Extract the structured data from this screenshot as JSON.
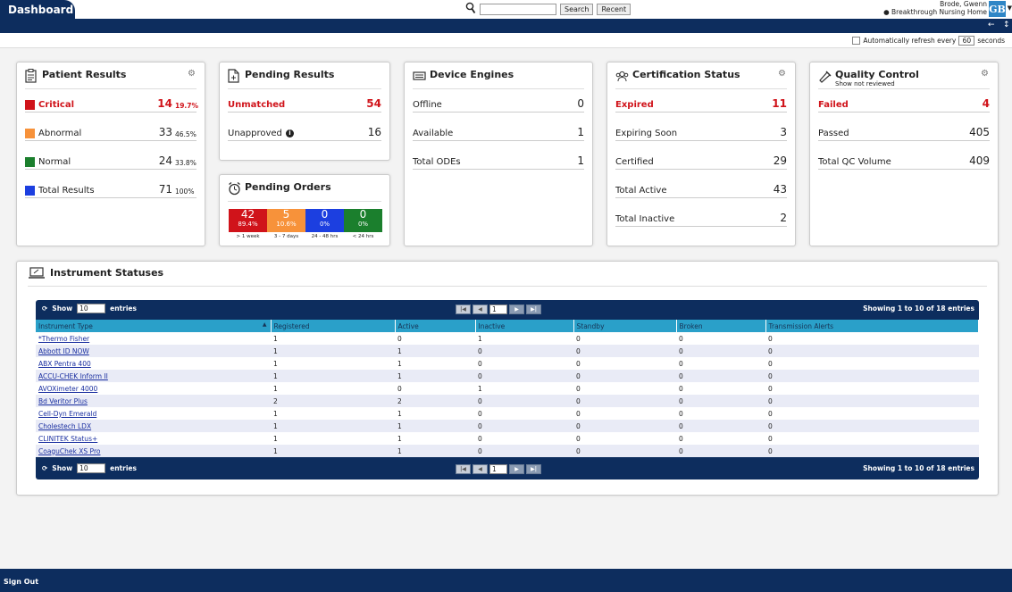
{
  "header": {
    "tab_title": "Dashboard",
    "search_placeholder": "",
    "search_button": "Search",
    "recent_button": "Recent",
    "user_name": "Brode, Gwenn",
    "location": "Breakthrough Nursing Home",
    "avatar_initials": "GB"
  },
  "nav": {
    "left_arrow": "←",
    "right_icon": "↕"
  },
  "refresh": {
    "label": "Automatically refresh every",
    "seconds_value": "60",
    "seconds_label": "seconds"
  },
  "patient_results": {
    "title": "Patient Results",
    "rows": [
      {
        "label": "Critical",
        "value": "14",
        "pct": "19.7%",
        "color": "#d0131a"
      },
      {
        "label": "Abnormal",
        "value": "33",
        "pct": "46.5%",
        "color": "#f7923a"
      },
      {
        "label": "Normal",
        "value": "24",
        "pct": "33.8%",
        "color": "#1b7f2d"
      },
      {
        "label": "Total Results",
        "value": "71",
        "pct": "100%",
        "color": "#1c3fe0"
      }
    ]
  },
  "pending_results": {
    "title": "Pending Results",
    "rows": [
      {
        "label": "Unmatched",
        "value": "54"
      },
      {
        "label": "Unapproved",
        "value": "16"
      }
    ]
  },
  "pending_orders": {
    "title": "Pending Orders",
    "blocks": [
      {
        "count": "42",
        "pct": "89.4%",
        "label": "> 1 week",
        "color": "#d0131a"
      },
      {
        "count": "5",
        "pct": "10.6%",
        "label": "3 - 7 days",
        "color": "#f7923a"
      },
      {
        "count": "0",
        "pct": "0%",
        "label": "24 - 48 hrs",
        "color": "#1c3fe0"
      },
      {
        "count": "0",
        "pct": "0%",
        "label": "< 24 hrs",
        "color": "#1b7f2d"
      }
    ]
  },
  "device_engines": {
    "title": "Device Engines",
    "rows": [
      {
        "label": "Offline",
        "value": "0"
      },
      {
        "label": "Available",
        "value": "1"
      },
      {
        "label": "Total ODEs",
        "value": "1"
      }
    ]
  },
  "certification_status": {
    "title": "Certification Status",
    "rows": [
      {
        "label": "Expired",
        "value": "11"
      },
      {
        "label": "Expiring Soon",
        "value": "3"
      },
      {
        "label": "Certified",
        "value": "29"
      },
      {
        "label": "Total Active",
        "value": "43"
      },
      {
        "label": "Total Inactive",
        "value": "2"
      }
    ]
  },
  "quality_control": {
    "title": "Quality Control",
    "subtitle": "Show not reviewed",
    "rows": [
      {
        "label": "Failed",
        "value": "4"
      },
      {
        "label": "Passed",
        "value": "405"
      },
      {
        "label": "Total QC Volume",
        "value": "409"
      }
    ]
  },
  "instrument_statuses": {
    "title": "Instrument Statuses",
    "show_label": "Show",
    "entries_value": "10",
    "entries_label": "entries",
    "page": "1",
    "showing": "Showing 1 to 10 of 18 entries",
    "columns": [
      "Instrument Type",
      "Registered",
      "Active",
      "Inactive",
      "Standby",
      "Broken",
      "Transmission Alerts"
    ],
    "rows": [
      [
        "*Thermo Fisher",
        "1",
        "0",
        "1",
        "0",
        "0",
        "0"
      ],
      [
        "Abbott ID NOW",
        "1",
        "1",
        "0",
        "0",
        "0",
        "0"
      ],
      [
        "ABX Pentra 400",
        "1",
        "1",
        "0",
        "0",
        "0",
        "0"
      ],
      [
        "ACCU-CHEK Inform II",
        "1",
        "1",
        "0",
        "0",
        "0",
        "0"
      ],
      [
        "AVOXimeter 4000",
        "1",
        "0",
        "1",
        "0",
        "0",
        "0"
      ],
      [
        "Bd Veritor Plus",
        "2",
        "2",
        "0",
        "0",
        "0",
        "0"
      ],
      [
        "Cell-Dyn Emerald",
        "1",
        "1",
        "0",
        "0",
        "0",
        "0"
      ],
      [
        "Cholestech LDX",
        "1",
        "1",
        "0",
        "0",
        "0",
        "0"
      ],
      [
        "CLINITEK Status+",
        "1",
        "1",
        "0",
        "0",
        "0",
        "0"
      ],
      [
        "CoaguChek XS Pro",
        "1",
        "1",
        "0",
        "0",
        "0",
        "0"
      ]
    ]
  },
  "footer": {
    "sign_out": "Sign Out"
  }
}
